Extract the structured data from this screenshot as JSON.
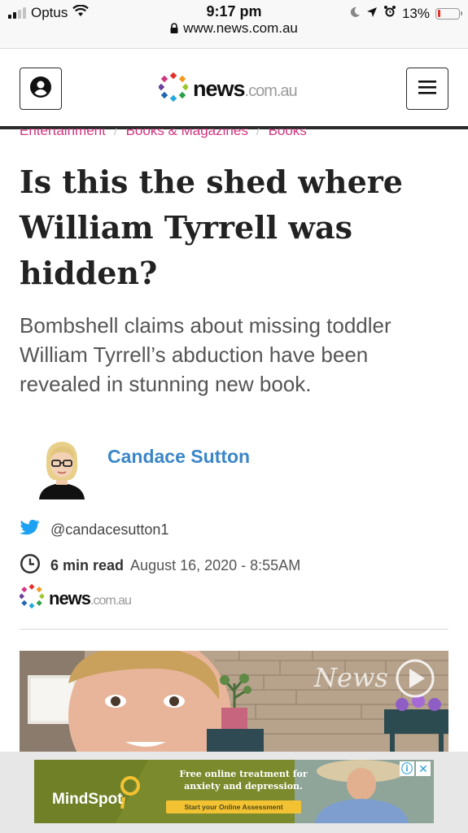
{
  "status_bar": {
    "carrier": "Optus",
    "time": "9:17 pm",
    "url": "www.news.com.au",
    "battery": "13%",
    "battery_level": 0.13
  },
  "header": {
    "logo_main": "news",
    "logo_suffix": ".com.au"
  },
  "breadcrumb": [
    "Entertainment",
    "Books & Magazines",
    "Books"
  ],
  "article": {
    "headline": "Is this the shed where William Tyrrell was hidden?",
    "standfirst": "Bombshell claims about missing toddler William Tyrrell’s abduction have been revealed in stunning new book.",
    "author": "Candace Sutton",
    "twitter_handle": "@candacesutton1",
    "read_time": "6 min read",
    "date": "August 16, 2020 - 8:55AM",
    "source_logo_main": "news",
    "source_logo_suffix": ".com.au",
    "image_watermark": "News"
  },
  "ad": {
    "brand": "MindSpot",
    "copy_line1": "Free online treatment for",
    "copy_line2": "anxiety and depression.",
    "cta": "Start your Online Assessment"
  },
  "colors": {
    "breadcrumb": "#d0357f",
    "author": "#3b86c8",
    "twitter": "#1da1f2",
    "ad_background": "#7b8a2c",
    "ad_cta": "#f2c233"
  },
  "icons": {
    "user": "user-circle-icon",
    "menu": "hamburger-icon",
    "twitter": "twitter-bird-icon",
    "clock": "clock-icon",
    "lock": "lock-icon",
    "play": "play-icon"
  }
}
